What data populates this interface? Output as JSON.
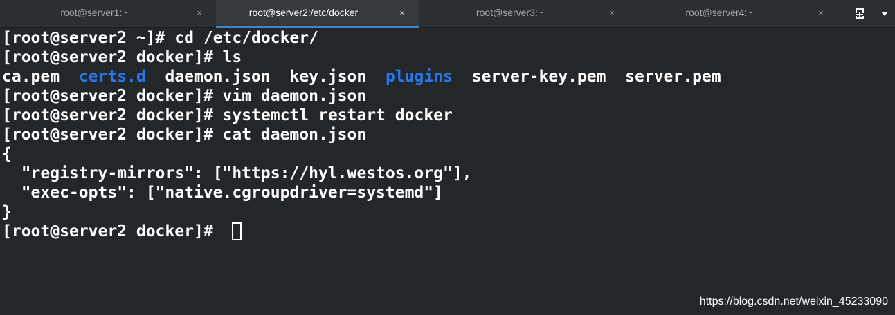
{
  "tabs": [
    {
      "label": "root@server1:~",
      "active": false
    },
    {
      "label": "root@server2:/etc/docker",
      "active": true
    },
    {
      "label": "root@server3:~",
      "active": false
    },
    {
      "label": "root@server4:~",
      "active": false
    }
  ],
  "tab_close_glyph": "×",
  "icons": {
    "new_tab": "new-tab-icon",
    "menu": "menu-dropdown-icon"
  },
  "colors": {
    "background": "#23272a",
    "text": "#ffffff",
    "directory": "#2a77ea",
    "active_tab_accent": "#3d85c6"
  },
  "terminal": {
    "prompt_home": "[root@server2 ~]# ",
    "prompt_docker": "[root@server2 docker]# ",
    "lines": [
      {
        "cmd": "cd /etc/docker/"
      },
      {
        "cmd": "ls"
      },
      {
        "files": [
          "ca.pem",
          "certs.d",
          "daemon.json",
          "key.json",
          "plugins",
          "server-key.pem",
          "server.pem"
        ]
      },
      {
        "cmd": "vim daemon.json"
      },
      {
        "cmd": "systemctl restart docker"
      },
      {
        "cmd": "cat daemon.json"
      },
      {
        "text": "{"
      },
      {
        "text": "  \"registry-mirrors\": [\"https://hyl.westos.org\"],"
      },
      {
        "text": "  \"exec-opts\": [\"native.cgroupdriver=systemd\"]"
      },
      {
        "text": "}"
      }
    ]
  },
  "watermark": "https://blog.csdn.net/weixin_45233090"
}
